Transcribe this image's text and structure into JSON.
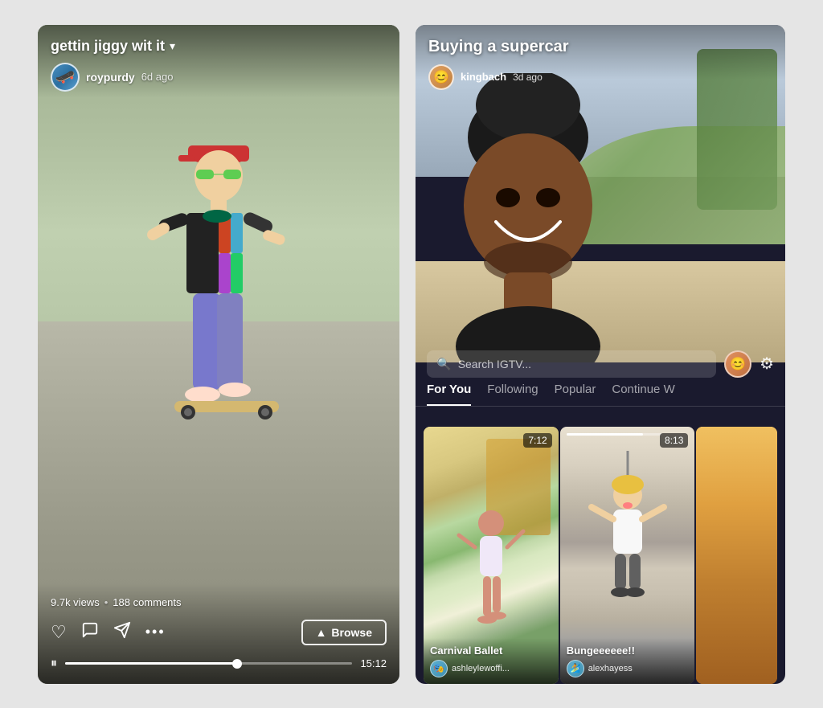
{
  "left_panel": {
    "video_title": "gettin jiggy wit it",
    "dropdown_symbol": "▾",
    "user": {
      "name": "roypurdy",
      "time_ago": "6d ago"
    },
    "stats": {
      "views": "9.7k views",
      "separator": "•",
      "comments": "188 comments"
    },
    "actions": {
      "like_icon": "♡",
      "comment_icon": "💬",
      "share_icon": "➤",
      "more_icon": "•••"
    },
    "browse_button": "Browse",
    "browse_chevron": "▲",
    "progress": {
      "time": "15:12",
      "fill_percent": 60
    },
    "pause_icon": "⏸"
  },
  "right_panel": {
    "video_title": "Buying a supercar",
    "user": {
      "name": "kingbach",
      "time_ago": "3d ago"
    },
    "search": {
      "placeholder": "Search IGTV...",
      "icon": "🔍"
    },
    "nav_tabs": [
      {
        "label": "For You",
        "active": true
      },
      {
        "label": "Following",
        "active": false
      },
      {
        "label": "Popular",
        "active": false
      },
      {
        "label": "Continue W",
        "active": false
      }
    ],
    "thumbnails": [
      {
        "title": "Carnival Ballet",
        "username": "ashleylewoffi...",
        "duration": "7:12",
        "has_progress": false
      },
      {
        "title": "Bungeeeeee!!",
        "username": "alexhayess",
        "duration": "8:13",
        "has_progress": true
      },
      {
        "title": "",
        "username": "",
        "duration": "",
        "has_progress": false
      }
    ]
  }
}
